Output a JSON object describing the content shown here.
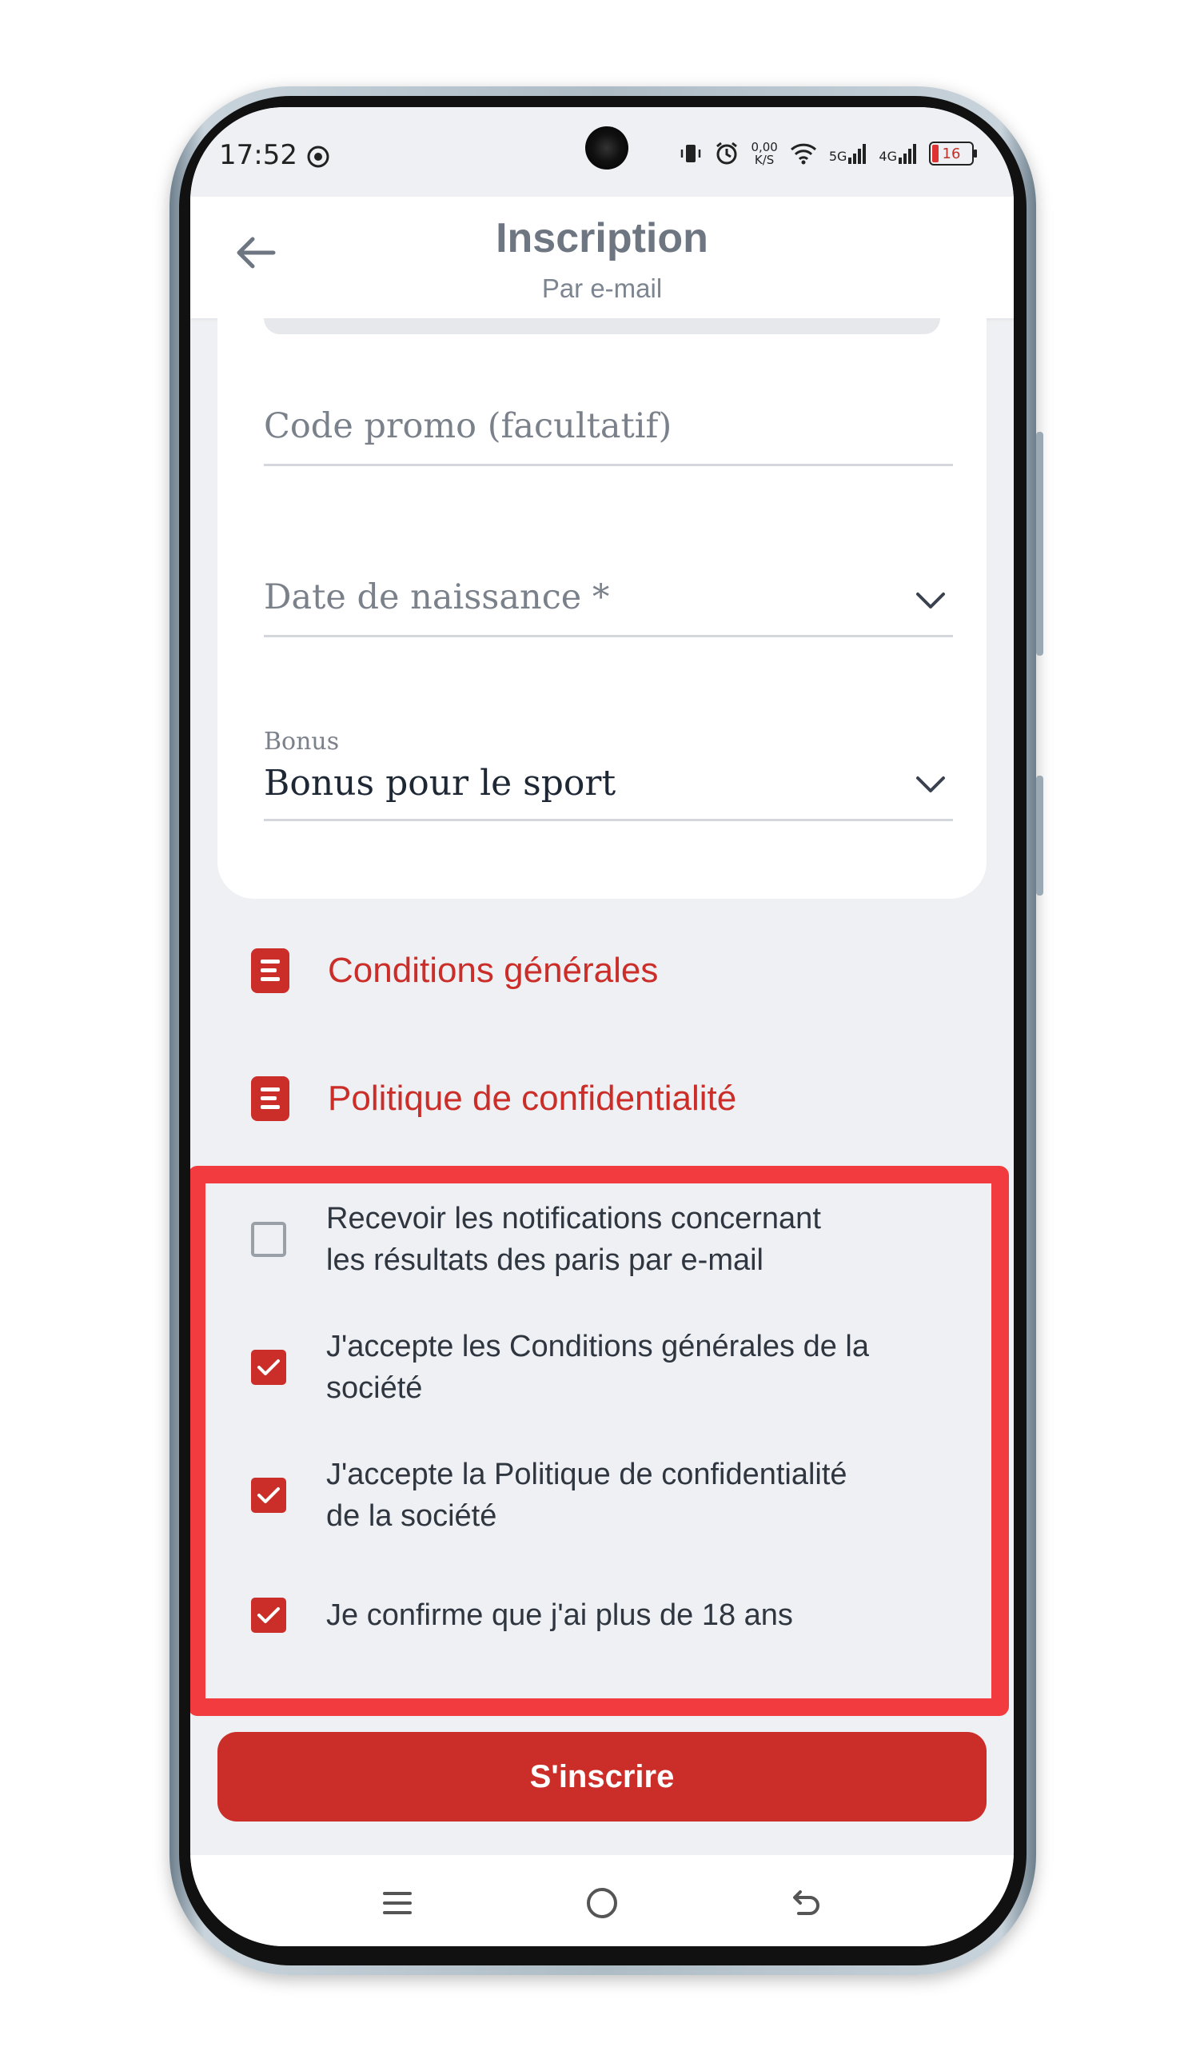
{
  "status_bar": {
    "time": "17:52",
    "net_speed": "0,00\nK/S",
    "net_1": "5G",
    "net_2": "4G",
    "battery": "16"
  },
  "header": {
    "title": "Inscription",
    "subtitle": "Par e-mail"
  },
  "form": {
    "promo_placeholder": "Code promo (facultatif)",
    "birthdate_placeholder": "Date de naissance *",
    "bonus_label": "Bonus",
    "bonus_value": "Bonus pour le sport"
  },
  "links": {
    "terms": "Conditions générales",
    "privacy": "Politique de confidentialité"
  },
  "consents": [
    {
      "line1": "Recevoir les notifications concernant",
      "line2": "les résultats des paris par e-mail",
      "checked": false
    },
    {
      "line1": "J'accepte les Conditions générales de la",
      "line2": "société",
      "checked": true
    },
    {
      "line1": "J'accepte la Politique de confidentialité",
      "line2": "de la société",
      "checked": true
    },
    {
      "line1": "Je confirme que j'ai plus de 18 ans",
      "line2": "",
      "checked": true
    }
  ],
  "submit_label": "S'inscrire",
  "colors": {
    "brand_red": "#cb2e29",
    "highlight_red": "#f13b3e",
    "background": "#eef0f3"
  },
  "icons": [
    "back-arrow-icon",
    "chevron-down-icon",
    "document-icon",
    "check-icon",
    "menu-icon",
    "home-icon",
    "back-icon"
  ]
}
